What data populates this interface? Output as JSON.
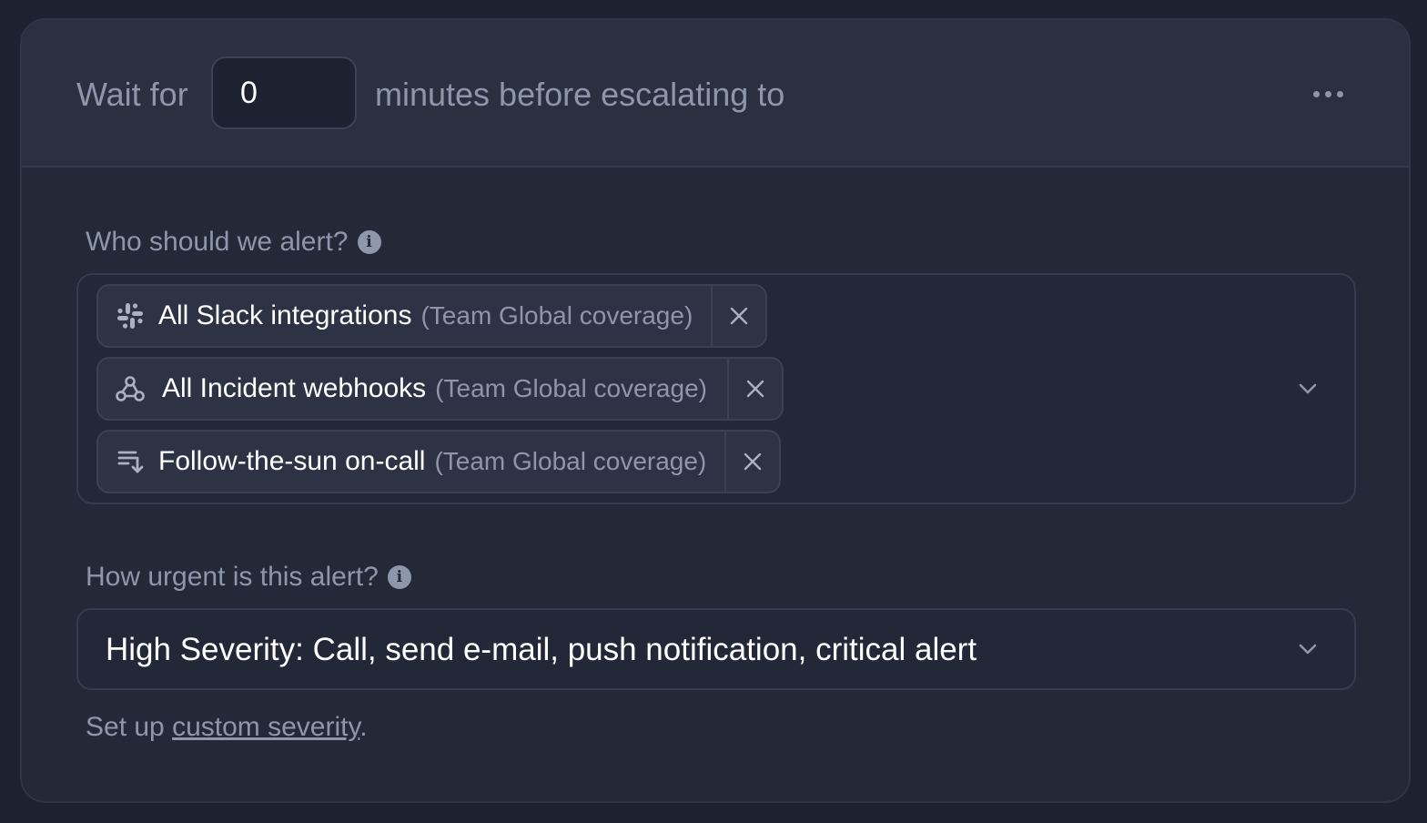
{
  "header": {
    "wait_prefix": "Wait for",
    "wait_minutes": "0",
    "wait_suffix": "minutes before escalating to",
    "more_icon": "more-horizontal-icon"
  },
  "targets": {
    "label": "Who should we alert?",
    "chips": [
      {
        "name": "All Slack integrations",
        "sub": "(Team Global coverage)",
        "icon": "slack-icon"
      },
      {
        "name": "All Incident webhooks",
        "sub": "(Team Global coverage)",
        "icon": "webhook-icon"
      },
      {
        "name": "Follow-the-sun on-call",
        "sub": "(Team Global coverage)",
        "icon": "schedule-icon"
      }
    ]
  },
  "urgency": {
    "label": "How urgent is this alert?",
    "selected": "High Severity: Call, send e-mail, push notification, critical alert"
  },
  "footer": {
    "prefix": "Set up ",
    "link": "custom severity",
    "suffix": "."
  },
  "colors": {
    "background": "#1e2230",
    "card": "#232937",
    "header": "#2b3041",
    "muted_text": "#8e96ab",
    "chip": "#2d3344"
  }
}
